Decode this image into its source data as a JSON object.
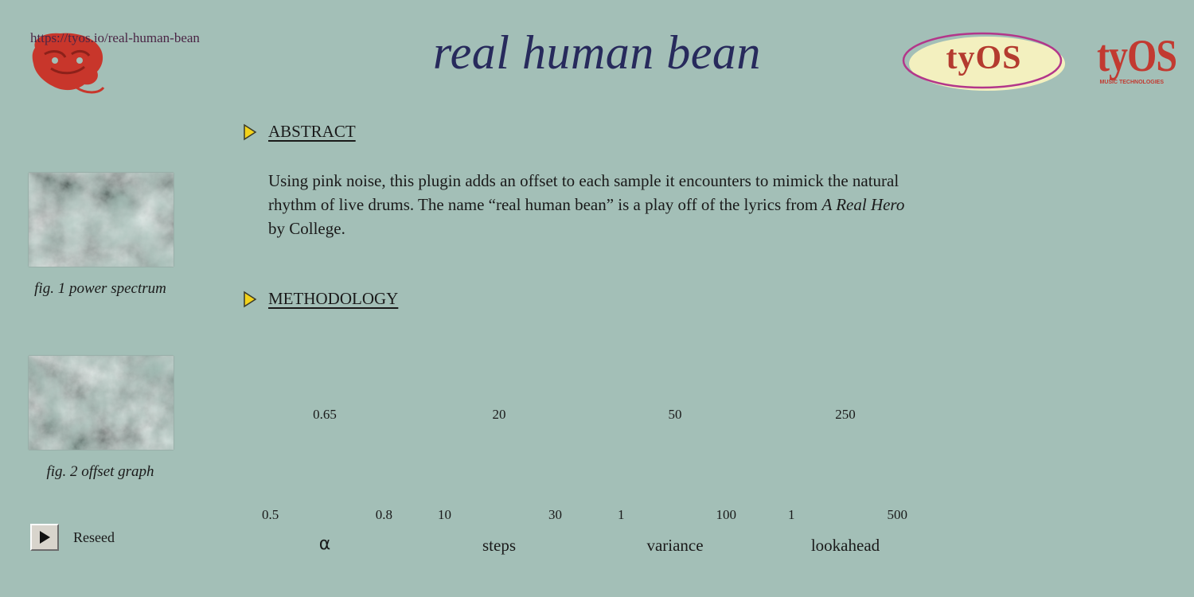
{
  "header": {
    "url": "https://tyos.io/real-human-bean",
    "title": "real human bean",
    "brand_oval": "tyOS",
    "brand_mark": "tyOS",
    "brand_mark_sub": "MUSIC TECHNOLOGIES"
  },
  "figures": [
    {
      "caption": "fig. 1 power spectrum",
      "icon": "noise-image"
    },
    {
      "caption": "fig. 2 offset graph",
      "icon": "noise-image"
    }
  ],
  "reseed": {
    "label": "Reseed",
    "icon": "play-icon"
  },
  "sections": {
    "abstract": {
      "heading": "ABSTRACT",
      "text_before": "Using pink noise, this plugin adds an offset to each sample it encounters to mimick the natural rhythm of live drums. The name “real human bean” is a play off of the lyrics from ",
      "italic_title": "A Real Hero",
      "text_after": " by College."
    },
    "methodology": {
      "heading": "METHODOLOGY"
    }
  },
  "params": [
    {
      "name": "α",
      "value": "0.65",
      "min": "0.5",
      "max": "0.8"
    },
    {
      "name": "steps",
      "value": "20",
      "min": "10",
      "max": "30"
    },
    {
      "name": "variance",
      "value": "50",
      "min": "1",
      "max": "100"
    },
    {
      "name": "lookahead",
      "value": "250",
      "min": "1",
      "max": "500"
    }
  ],
  "colors": {
    "background": "#a3bfb7",
    "title": "#272a5c",
    "brand_red": "#c23a31",
    "section_arrow": "#f2d21b"
  }
}
